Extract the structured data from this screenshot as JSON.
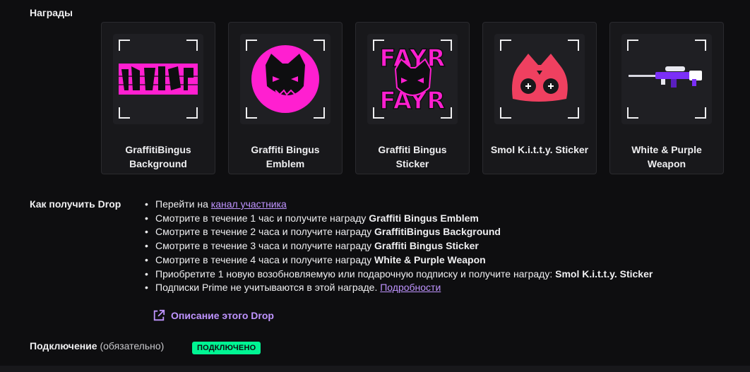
{
  "rewards_section": {
    "title": "Награды",
    "items": [
      {
        "name_line1": "GraffitiBingus",
        "name_line2": "Background",
        "icon": "pink-graffiti-banner-icon"
      },
      {
        "name_line1": "Graffiti Bingus",
        "name_line2": "Emblem",
        "icon": "pink-cat-emblem-icon"
      },
      {
        "name_line1": "Graffiti Bingus",
        "name_line2": "Sticker",
        "icon": "graffiti-cat-sticker-icon"
      },
      {
        "name_line1": "Smol K.i.t.t.y. Sticker",
        "name_line2": "",
        "icon": "red-kitty-sticker-icon"
      },
      {
        "name_line1": "White & Purple",
        "name_line2": "Weapon",
        "icon": "sniper-rifle-icon"
      }
    ]
  },
  "how_to": {
    "title": "Как получить Drop",
    "steps": [
      {
        "text": "Перейти на ",
        "link": "канал участника"
      },
      {
        "text": "Смотрите в течение 1 час и получите награду ",
        "bold": "Graffiti Bingus Emblem"
      },
      {
        "text": "Смотрите в течение 2 часа и получите награду ",
        "bold": "GraffitiBingus Background"
      },
      {
        "text": "Смотрите в течение 3 часа и получите награду ",
        "bold": "Graffiti Bingus Sticker"
      },
      {
        "text": "Смотрите в течение 4 часа и получите награду ",
        "bold": "White & Purple Weapon"
      },
      {
        "text": "Приобретите 1 новую возобновляемую или подарочную подписку и получите награду: ",
        "bold": "Smol K.i.t.t.y. Sticker"
      },
      {
        "text": "Подписки Prime не учитываются в этой награде. ",
        "link": "Подробности"
      }
    ],
    "description_link": "Описание этого Drop"
  },
  "connection": {
    "label": "Подключение",
    "note": "(обязательно)",
    "status": "ПОДКЛЮЧЕНО"
  },
  "colors": {
    "accent": "#bf94ff",
    "status": "#00f593",
    "card_bg": "#18181b"
  }
}
